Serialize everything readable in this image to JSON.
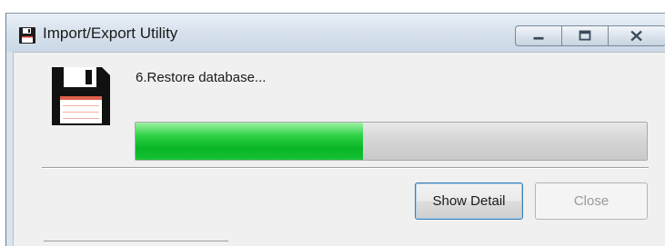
{
  "window": {
    "title": "Import/Export Utility",
    "controls": {
      "minimize": "minimize-icon",
      "maximize": "maximize-icon",
      "close": "close-icon"
    }
  },
  "status": {
    "step_text": "6.Restore database...",
    "progress": 0.445
  },
  "buttons": {
    "show_detail": "Show Detail",
    "close": "Close",
    "close_enabled": false
  },
  "colors": {
    "progress_fill": "#08b526",
    "title_bar": "#d6e1ec"
  }
}
